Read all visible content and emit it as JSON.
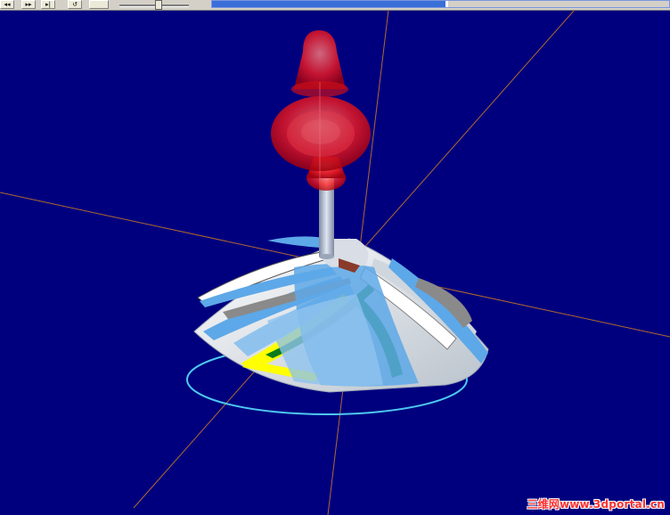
{
  "toolbar": {
    "buttons": [
      {
        "name": "step-back-icon",
        "glyph": "◂◂"
      },
      {
        "name": "step-forward-icon",
        "glyph": "▸▸"
      },
      {
        "name": "skip-forward-icon",
        "glyph": "▸|"
      },
      {
        "name": "reset-icon",
        "glyph": "↺"
      },
      {
        "name": "stop-icon",
        "glyph": ""
      }
    ],
    "speed_slider_level": 0.55,
    "progress_fraction": 0.51
  },
  "scene": {
    "background": "#00007f",
    "axis_color": "#b06a2a",
    "tool_color": "#ff1a1a",
    "shaft_color": "#b8c4d8",
    "blade_colors": [
      "#5da8e8",
      "#ffffff",
      "#ffff00",
      "#0a7a1a",
      "#8a8a8a"
    ],
    "base_ring_color": "#4ec8f0"
  },
  "watermark": "三维网www.3dportal.cn"
}
